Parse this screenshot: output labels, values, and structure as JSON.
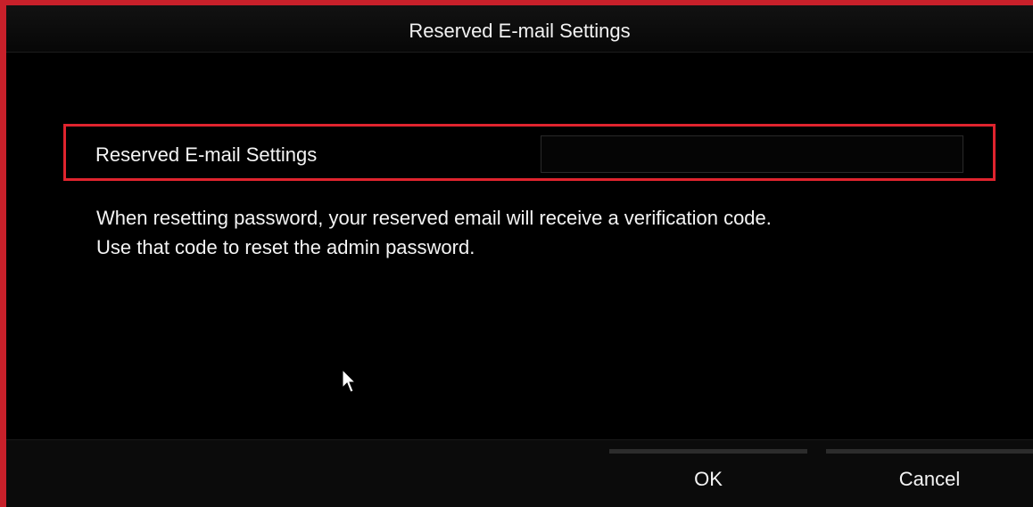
{
  "dialog": {
    "title": "Reserved E-mail Settings",
    "setting": {
      "label": "Reserved E-mail Settings",
      "value": ""
    },
    "description_lines": [
      "When resetting password, your reserved email will receive a verification code.",
      "Use that code to reset the admin password."
    ],
    "buttons": {
      "ok": "OK",
      "cancel": "Cancel"
    }
  },
  "colors": {
    "highlight": "#e0242e",
    "frame_accent": "#c8202a",
    "background": "#000000",
    "text": "#f4f4f4"
  }
}
